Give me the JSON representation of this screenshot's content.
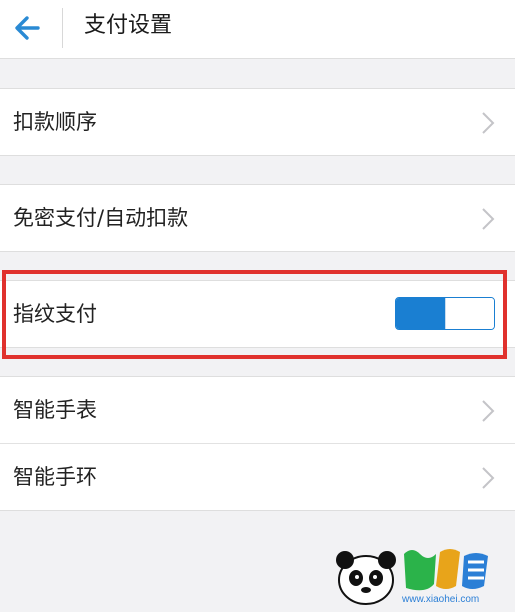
{
  "header": {
    "back_icon": "arrow-left-icon",
    "title": "支付设置"
  },
  "sections": [
    {
      "items": [
        {
          "label": "扣款顺序",
          "icon": "chevron-right-icon"
        }
      ]
    },
    {
      "items": [
        {
          "label": "免密支付/自动扣款",
          "icon": "chevron-right-icon"
        }
      ]
    },
    {
      "items": [
        {
          "label": "指纹支付",
          "toggle_on": true
        }
      ]
    },
    {
      "items": [
        {
          "label": "智能手表",
          "icon": "chevron-right-icon"
        },
        {
          "label": "智能手环",
          "icon": "chevron-right-icon"
        }
      ]
    }
  ],
  "toggle": {
    "level": 0.5
  },
  "colors": {
    "accent": "#1a7fd2",
    "highlight": "#e0312d",
    "background": "#f2f2f4",
    "chevron": "#c4c4c8"
  },
  "watermark": {
    "url_text": "www.xiaohei.com",
    "logo": "panda-logo"
  }
}
